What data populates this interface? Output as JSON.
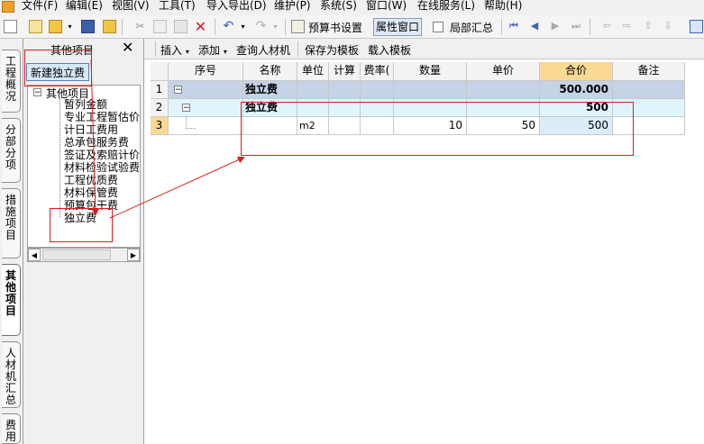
{
  "menu": [
    "文件(F)",
    "编辑(E)",
    "视图(V)",
    "工具(T)",
    "导入导出(D)",
    "维护(P)",
    "系统(S)",
    "窗口(W)",
    "在线服务(L)",
    "帮助(H)"
  ],
  "toolbar": {
    "budget_settings": "预算书设置",
    "property_window": "属性窗口",
    "partial_summary": "局部汇总"
  },
  "vertical_tabs": [
    "工程概况",
    "分部分项",
    "措施项目",
    "其他项目",
    "人材机汇总",
    "费用"
  ],
  "left_panel": {
    "title": "其他项目",
    "close": "✕",
    "new_button": "新建独立费",
    "tree_root": "其他项目",
    "tree_items": [
      "暂列金额",
      "专业工程暂估价",
      "计日工费用",
      "总承包服务费",
      "签证及索赔计价",
      "材料检验试验费",
      "工程优质费",
      "材料保管费",
      "预算包干费",
      "独立费"
    ]
  },
  "main_toolbar": {
    "insert": "插入",
    "add": "添加",
    "query_materials": "查询人材机",
    "save_template": "保存为模板",
    "load_template": "载入模板"
  },
  "grid": {
    "headers": [
      "",
      "序号",
      "名称",
      "单位",
      "计算",
      "费率(",
      "数量",
      "单价",
      "合价",
      "备注"
    ],
    "rows": [
      {
        "num": "1",
        "name": "独立费",
        "unit": "",
        "qty": "",
        "price": "",
        "total": "500.000"
      },
      {
        "num": "2",
        "name": "独立费",
        "unit": "",
        "qty": "",
        "price": "",
        "total": "500"
      },
      {
        "num": "3",
        "name": "",
        "unit": "m2",
        "qty": "10",
        "price": "50",
        "total": "500"
      }
    ]
  },
  "colors": {
    "annotation": "#d81e1e",
    "header_highlight": "#fbd894",
    "row1": "#c6d3e6",
    "row2": "#e0f5fb"
  }
}
